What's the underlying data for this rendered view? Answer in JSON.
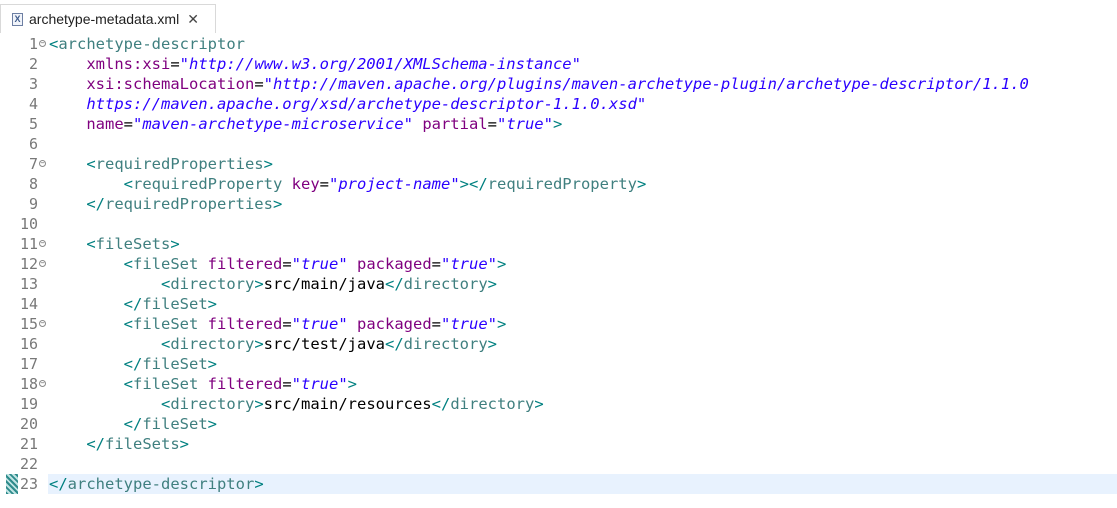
{
  "tab": {
    "title": "archetype-metadata.xml",
    "icon": "xml-file-icon",
    "close_symbol": "✕"
  },
  "editor": {
    "current_line": 23,
    "lines": [
      {
        "n": "1",
        "fold": true,
        "segs": [
          [
            "bp",
            "<"
          ],
          [
            "tg",
            "archetype-descriptor"
          ]
        ]
      },
      {
        "n": "2",
        "fold": false,
        "segs": [
          [
            "tx",
            "    "
          ],
          [
            "an",
            "xmlns:xsi"
          ],
          [
            "tx",
            "="
          ],
          [
            "av",
            "\"http://www.w3.org/2001/XMLSchema-instance\""
          ]
        ]
      },
      {
        "n": "3",
        "fold": false,
        "segs": [
          [
            "tx",
            "    "
          ],
          [
            "an",
            "xsi:schemaLocation"
          ],
          [
            "tx",
            "="
          ],
          [
            "av",
            "\"http://maven.apache.org/plugins/maven-archetype-plugin/archetype-descriptor/1.1.0"
          ]
        ]
      },
      {
        "n": "4",
        "fold": false,
        "segs": [
          [
            "tx",
            "    "
          ],
          [
            "av",
            "https://maven.apache.org/xsd/archetype-descriptor-1.1.0.xsd\""
          ]
        ]
      },
      {
        "n": "5",
        "fold": false,
        "segs": [
          [
            "tx",
            "    "
          ],
          [
            "an",
            "name"
          ],
          [
            "tx",
            "="
          ],
          [
            "av",
            "\"maven-archetype-microservice\""
          ],
          [
            "tx",
            " "
          ],
          [
            "an",
            "partial"
          ],
          [
            "tx",
            "="
          ],
          [
            "av",
            "\"true\""
          ],
          [
            "bp",
            ">"
          ]
        ]
      },
      {
        "n": "6",
        "fold": false,
        "segs": []
      },
      {
        "n": "7",
        "fold": true,
        "segs": [
          [
            "tx",
            "    "
          ],
          [
            "bp",
            "<"
          ],
          [
            "tg",
            "requiredProperties"
          ],
          [
            "bp",
            ">"
          ]
        ]
      },
      {
        "n": "8",
        "fold": false,
        "segs": [
          [
            "tx",
            "        "
          ],
          [
            "bp",
            "<"
          ],
          [
            "tg",
            "requiredProperty"
          ],
          [
            "tx",
            " "
          ],
          [
            "an",
            "key"
          ],
          [
            "tx",
            "="
          ],
          [
            "av",
            "\"project-name\""
          ],
          [
            "bp",
            "></"
          ],
          [
            "tg",
            "requiredProperty"
          ],
          [
            "bp",
            ">"
          ]
        ]
      },
      {
        "n": "9",
        "fold": false,
        "segs": [
          [
            "tx",
            "    "
          ],
          [
            "bp",
            "</"
          ],
          [
            "tg",
            "requiredProperties"
          ],
          [
            "bp",
            ">"
          ]
        ]
      },
      {
        "n": "10",
        "fold": false,
        "segs": []
      },
      {
        "n": "11",
        "fold": true,
        "segs": [
          [
            "tx",
            "    "
          ],
          [
            "bp",
            "<"
          ],
          [
            "tg",
            "fileSets"
          ],
          [
            "bp",
            ">"
          ]
        ]
      },
      {
        "n": "12",
        "fold": true,
        "segs": [
          [
            "tx",
            "        "
          ],
          [
            "bp",
            "<"
          ],
          [
            "tg",
            "fileSet"
          ],
          [
            "tx",
            " "
          ],
          [
            "an",
            "filtered"
          ],
          [
            "tx",
            "="
          ],
          [
            "av",
            "\"true\""
          ],
          [
            "tx",
            " "
          ],
          [
            "an",
            "packaged"
          ],
          [
            "tx",
            "="
          ],
          [
            "av",
            "\"true\""
          ],
          [
            "bp",
            ">"
          ]
        ]
      },
      {
        "n": "13",
        "fold": false,
        "segs": [
          [
            "tx",
            "            "
          ],
          [
            "bp",
            "<"
          ],
          [
            "tg",
            "directory"
          ],
          [
            "bp",
            ">"
          ],
          [
            "tx",
            "src/main/java"
          ],
          [
            "bp",
            "</"
          ],
          [
            "tg",
            "directory"
          ],
          [
            "bp",
            ">"
          ]
        ]
      },
      {
        "n": "14",
        "fold": false,
        "segs": [
          [
            "tx",
            "        "
          ],
          [
            "bp",
            "</"
          ],
          [
            "tg",
            "fileSet"
          ],
          [
            "bp",
            ">"
          ]
        ]
      },
      {
        "n": "15",
        "fold": true,
        "segs": [
          [
            "tx",
            "        "
          ],
          [
            "bp",
            "<"
          ],
          [
            "tg",
            "fileSet"
          ],
          [
            "tx",
            " "
          ],
          [
            "an",
            "filtered"
          ],
          [
            "tx",
            "="
          ],
          [
            "av",
            "\"true\""
          ],
          [
            "tx",
            " "
          ],
          [
            "an",
            "packaged"
          ],
          [
            "tx",
            "="
          ],
          [
            "av",
            "\"true\""
          ],
          [
            "bp",
            ">"
          ]
        ]
      },
      {
        "n": "16",
        "fold": false,
        "segs": [
          [
            "tx",
            "            "
          ],
          [
            "bp",
            "<"
          ],
          [
            "tg",
            "directory"
          ],
          [
            "bp",
            ">"
          ],
          [
            "tx",
            "src/test/java"
          ],
          [
            "bp",
            "</"
          ],
          [
            "tg",
            "directory"
          ],
          [
            "bp",
            ">"
          ]
        ]
      },
      {
        "n": "17",
        "fold": false,
        "segs": [
          [
            "tx",
            "        "
          ],
          [
            "bp",
            "</"
          ],
          [
            "tg",
            "fileSet"
          ],
          [
            "bp",
            ">"
          ]
        ]
      },
      {
        "n": "18",
        "fold": true,
        "segs": [
          [
            "tx",
            "        "
          ],
          [
            "bp",
            "<"
          ],
          [
            "tg",
            "fileSet"
          ],
          [
            "tx",
            " "
          ],
          [
            "an",
            "filtered"
          ],
          [
            "tx",
            "="
          ],
          [
            "av",
            "\"true\""
          ],
          [
            "bp",
            ">"
          ]
        ]
      },
      {
        "n": "19",
        "fold": false,
        "segs": [
          [
            "tx",
            "            "
          ],
          [
            "bp",
            "<"
          ],
          [
            "tg",
            "directory"
          ],
          [
            "bp",
            ">"
          ],
          [
            "tx",
            "src/main/resources"
          ],
          [
            "bp",
            "</"
          ],
          [
            "tg",
            "directory"
          ],
          [
            "bp",
            ">"
          ]
        ]
      },
      {
        "n": "20",
        "fold": false,
        "segs": [
          [
            "tx",
            "        "
          ],
          [
            "bp",
            "</"
          ],
          [
            "tg",
            "fileSet"
          ],
          [
            "bp",
            ">"
          ]
        ]
      },
      {
        "n": "21",
        "fold": false,
        "segs": [
          [
            "tx",
            "    "
          ],
          [
            "bp",
            "</"
          ],
          [
            "tg",
            "fileSets"
          ],
          [
            "bp",
            ">"
          ]
        ]
      },
      {
        "n": "22",
        "fold": false,
        "segs": []
      },
      {
        "n": "23",
        "fold": false,
        "segs": [
          [
            "bp",
            "</"
          ],
          [
            "tg",
            "archetype-descriptor"
          ],
          [
            "bp",
            ">"
          ]
        ]
      }
    ]
  }
}
